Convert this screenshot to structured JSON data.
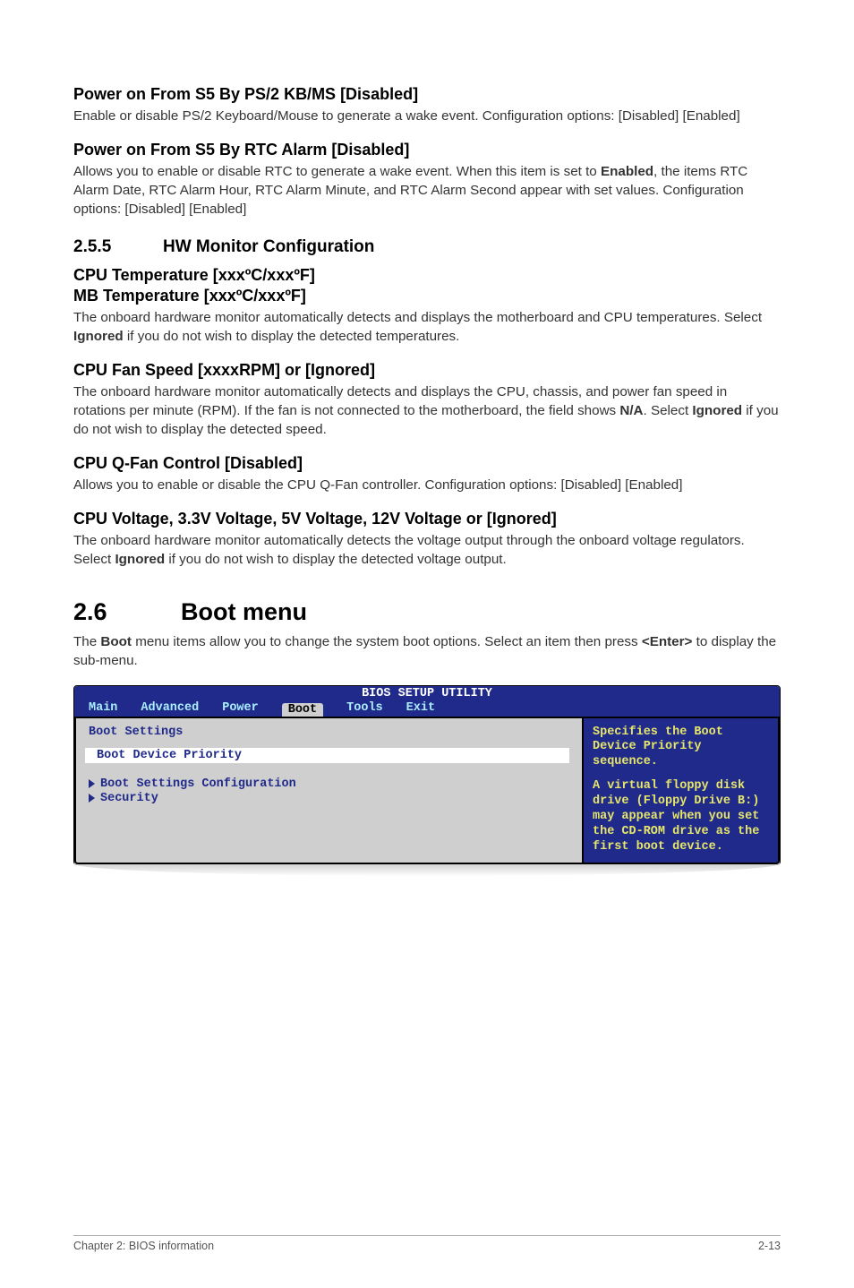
{
  "s1": {
    "h": "Power on From S5 By PS/2 KB/MS [Disabled]",
    "p": "Enable or disable PS/2 Keyboard/Mouse to generate a wake event. Configuration options: [Disabled] [Enabled]"
  },
  "s2": {
    "h": "Power on From S5 By RTC Alarm [Disabled]",
    "p1": "Allows you to enable or disable RTC to generate a wake event. When this item is set to ",
    "b": "Enabled",
    "p2": ", the items RTC Alarm Date, RTC Alarm Hour, RTC Alarm Minute, and RTC Alarm Second appear with set values. Configuration options: [Disabled] [Enabled]"
  },
  "s255": {
    "num": "2.5.5",
    "title": "HW Monitor Configuration"
  },
  "s3": {
    "h1": "CPU Temperature [xxxºC/xxxºF]",
    "h2": "MB Temperature [xxxºC/xxxºF]",
    "p1": "The onboard hardware monitor automatically detects and displays the motherboard and CPU temperatures. Select ",
    "b": "Ignored",
    "p2": " if you do not wish to display the detected temperatures."
  },
  "s4": {
    "h": "CPU Fan Speed [xxxxRPM] or [Ignored]",
    "p1": "The onboard hardware monitor automatically detects and displays the CPU, chassis, and power fan speed in rotations per minute (RPM). If the fan is not connected to the motherboard, the field shows ",
    "b1": "N/A",
    "p2": ". Select ",
    "b2": "Ignored",
    "p3": " if you do not wish to display the detected speed."
  },
  "s5": {
    "h": "CPU Q-Fan Control [Disabled]",
    "p": "Allows you to enable or disable the CPU Q-Fan controller. Configuration options: [Disabled] [Enabled]"
  },
  "s6": {
    "h": "CPU Voltage, 3.3V Voltage, 5V Voltage, 12V Voltage or [Ignored]",
    "p1": "The onboard hardware monitor automatically detects the voltage output through the onboard voltage regulators. Select ",
    "b": "Ignored",
    "p2": " if you do not wish to display the detected voltage output."
  },
  "s26": {
    "num": "2.6",
    "title": "Boot menu",
    "p1": "The ",
    "b1": "Boot",
    "p2": " menu items allow you to change the system boot options. Select an item then press ",
    "b2": "<Enter>",
    "p3": " to display the sub-menu."
  },
  "bios": {
    "title": "BIOS SETUP UTILITY",
    "tabs": {
      "main": "Main",
      "advanced": "Advanced",
      "power": "Power",
      "boot": "Boot",
      "tools": "Tools",
      "exit": "Exit"
    },
    "left": {
      "heading": "Boot Settings",
      "item1": "Boot Device Priority",
      "item2": "Boot Settings Configuration",
      "item3": "Security"
    },
    "help": {
      "l1": "Specifies the Boot Device Priority sequence.",
      "l2": "A virtual floppy disk drive (Floppy Drive B:) may appear when you set the CD-ROM drive as the first boot device."
    }
  },
  "footer": {
    "left": "Chapter 2: BIOS information",
    "right": "2-13"
  }
}
